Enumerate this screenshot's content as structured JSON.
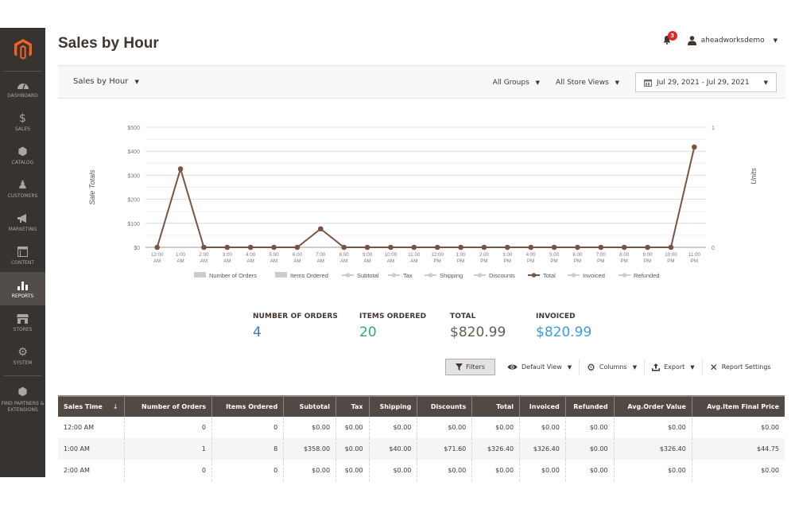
{
  "sidebar": {
    "logo": "magento-logo",
    "items": [
      {
        "label": "Dashboard",
        "icon": "gauge-icon"
      },
      {
        "label": "Sales",
        "icon": "dollar-icon"
      },
      {
        "label": "Catalog",
        "icon": "box-icon"
      },
      {
        "label": "Customers",
        "icon": "person-icon"
      },
      {
        "label": "Marketing",
        "icon": "megaphone-icon"
      },
      {
        "label": "Content",
        "icon": "layout-icon"
      },
      {
        "label": "Reports",
        "icon": "bar-chart-icon",
        "active": true
      },
      {
        "label": "Stores",
        "icon": "storefront-icon"
      },
      {
        "label": "System",
        "icon": "gear-icon"
      },
      {
        "label": "Find Partners & Extensions",
        "icon": "cube-icon"
      }
    ]
  },
  "header": {
    "title": "Sales by Hour",
    "notifications_count": "3",
    "username": "aheadworksdemo"
  },
  "filterbar": {
    "report_select": "Sales by Hour",
    "groups": "All Groups",
    "store_views": "All Store Views",
    "date_range": "Jul 29, 2021 - Jul 29, 2021"
  },
  "chart_data": {
    "type": "line",
    "title": "",
    "ylabel": "Sale Totals",
    "y2label": "Units",
    "ylim": [
      0,
      500
    ],
    "y2lim": [
      0,
      1
    ],
    "yticks": [
      "$0",
      "$100",
      "$200",
      "$300",
      "$400",
      "$500"
    ],
    "y2ticks": [
      "0",
      "1"
    ],
    "grid": true,
    "legend_position": "bottom",
    "x": [
      "12:00 AM",
      "1:00 AM",
      "2:00 AM",
      "3:00 AM",
      "4:00 AM",
      "5:00 AM",
      "6:00 AM",
      "7:00 AM",
      "8:00 AM",
      "9:00 AM",
      "10:00 AM",
      "11:00 AM",
      "12:00 PM",
      "1:00 PM",
      "2:00 PM",
      "3:00 PM",
      "4:00 PM",
      "5:00 PM",
      "6:00 PM",
      "7:00 PM",
      "8:00 PM",
      "9:00 PM",
      "10:00 PM",
      "11:00 PM"
    ],
    "legend": [
      {
        "name": "Number of Orders",
        "kind": "bar",
        "active": false
      },
      {
        "name": "Items Ordered",
        "kind": "bar",
        "active": false
      },
      {
        "name": "Subtotal",
        "kind": "line",
        "active": false
      },
      {
        "name": "Tax",
        "kind": "line",
        "active": false
      },
      {
        "name": "Shipping",
        "kind": "line",
        "active": false
      },
      {
        "name": "Discounts",
        "kind": "line",
        "active": false
      },
      {
        "name": "Total",
        "kind": "line",
        "active": true
      },
      {
        "name": "Invoiced",
        "kind": "line",
        "active": false
      },
      {
        "name": "Refunded",
        "kind": "line",
        "active": false
      }
    ],
    "series": [
      {
        "name": "Total",
        "color": "#7a5443",
        "values": [
          0,
          326.4,
          0,
          0,
          0,
          0,
          0,
          77.0,
          0,
          0,
          0,
          0,
          0,
          0,
          0,
          0,
          0,
          0,
          0,
          0,
          0,
          0,
          0,
          417.59
        ]
      }
    ]
  },
  "totals": [
    {
      "label": "NUMBER OF ORDERS",
      "value": "4",
      "color": "#4f6fb8"
    },
    {
      "label": "ITEMS ORDERED",
      "value": "20",
      "color": "#2ea58a"
    },
    {
      "label": "TOTAL",
      "value": "$820.99",
      "color": "#6a5a50"
    },
    {
      "label": "INVOICED",
      "value": "$820.99",
      "color": "#3d9be0"
    }
  ],
  "grid_toolbar": {
    "filters": "Filters",
    "default_view": "Default View",
    "columns": "Columns",
    "export": "Export",
    "report_settings": "Report Settings"
  },
  "table": {
    "columns": [
      "Sales Time",
      "Number of Orders",
      "Items Ordered",
      "Subtotal",
      "Tax",
      "Shipping",
      "Discounts",
      "Total",
      "Invoiced",
      "Refunded",
      "Avg.Order Value",
      "Avg.Item Final Price"
    ],
    "sort_indicator": "↓",
    "rows": [
      [
        "12:00 AM",
        "0",
        "0",
        "$0.00",
        "$0.00",
        "$0.00",
        "$0.00",
        "$0.00",
        "$0.00",
        "$0.00",
        "$0.00",
        "$0.00"
      ],
      [
        "1:00 AM",
        "1",
        "8",
        "$358.00",
        "$0.00",
        "$40.00",
        "$71.60",
        "$326.40",
        "$326.40",
        "$0.00",
        "$326.40",
        "$44.75"
      ],
      [
        "2:00 AM",
        "0",
        "0",
        "$0.00",
        "$0.00",
        "$0.00",
        "$0.00",
        "$0.00",
        "$0.00",
        "$0.00",
        "$0.00",
        "$0.00"
      ]
    ]
  }
}
